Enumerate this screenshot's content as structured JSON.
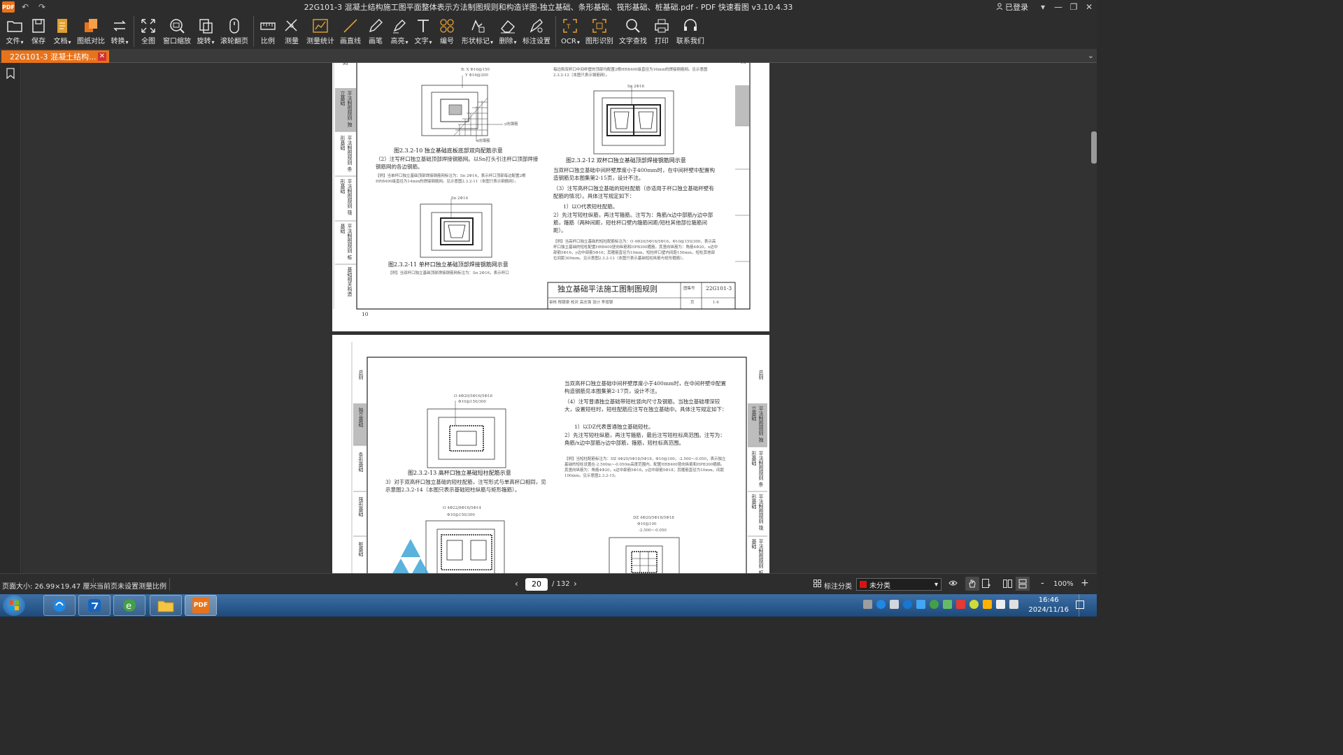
{
  "window": {
    "title": "22G101-3 混凝土结构施工图平面整体表示方法制图规则和构造详图-独立基础、条形基础、筏形基础、桩基础.pdf - PDF 快速看图 v3.10.4.33",
    "logo_text": "PDF",
    "login_label": "已登录"
  },
  "toolbar": {
    "items": [
      {
        "label": "文件",
        "icon": "folder-icon",
        "dropdown": true
      },
      {
        "label": "保存",
        "icon": "save-icon"
      },
      {
        "label": "文档",
        "icon": "document-icon",
        "dropdown": true
      },
      {
        "label": "图纸对比",
        "icon": "compare-icon"
      },
      {
        "label": "转换",
        "icon": "convert-icon",
        "dropdown": true
      },
      {
        "label": "全图",
        "icon": "fit-icon"
      },
      {
        "label": "窗口缩放",
        "icon": "zoom-window-icon"
      },
      {
        "label": "旋转",
        "icon": "rotate-icon",
        "dropdown": true
      },
      {
        "label": "滚轮翻页",
        "icon": "scroll-icon"
      },
      {
        "label": "比例",
        "icon": "scale-icon"
      },
      {
        "label": "测量",
        "icon": "measure-icon"
      },
      {
        "label": "测量统计",
        "icon": "measure-stats-icon"
      },
      {
        "label": "画直线",
        "icon": "line-icon"
      },
      {
        "label": "画笔",
        "icon": "pen-icon"
      },
      {
        "label": "高亮",
        "icon": "highlight-icon",
        "dropdown": true
      },
      {
        "label": "文字",
        "icon": "text-icon",
        "dropdown": true
      },
      {
        "label": "编号",
        "icon": "number-icon"
      },
      {
        "label": "形状标记",
        "icon": "shape-mark-icon",
        "dropdown": true
      },
      {
        "label": "删除",
        "icon": "eraser-icon",
        "dropdown": true
      },
      {
        "label": "标注设置",
        "icon": "annotation-settings-icon"
      },
      {
        "label": "OCR",
        "icon": "ocr-icon",
        "dropdown": true
      },
      {
        "label": "图形识别",
        "icon": "shape-recognition-icon"
      },
      {
        "label": "文字查找",
        "icon": "search-icon"
      },
      {
        "label": "打印",
        "icon": "print-icon"
      },
      {
        "label": "联系我们",
        "icon": "headset-icon"
      }
    ]
  },
  "tab": {
    "label": "22G101-3 混凝土结构...",
    "close": "✕"
  },
  "page1": {
    "top_label_left": "则",
    "top_label_right": "则",
    "fig1_annot1": "B: X Φ16@150",
    "fig1_annot2": "Y Φ16@200",
    "fig1_y": "y向钢筋",
    "fig1_x": "x向钢筋",
    "fig1_caption": "图2.3.2-10  独立基础底板底部双向配筋示意",
    "para1": "（2）注写杯口独立基础顶部焊接钢筋网。以Sn打头引注杯口顶部焊接钢筋网的各边钢筋。",
    "example1": "【例】当单杯口独立基础顶部焊接钢筋网标注为：Sn 2Φ14，表示杯口顶部每边配置2根HRB400级直径为14mm的焊接钢筋网。见示意图2.3.2-11（本图只表示钢筋网）。",
    "fig2_annot": "Sn 2Φ14",
    "fig2_caption": "图2.3.2-11  单杯口独立基础顶部焊接钢筋网示意",
    "example2": "【例】当双杯口独立基础顶部焊接钢筋网标注为：Sn 2Φ16，表示杯口",
    "right_top_text": "每边和双杯口中间杯壁的顶部均配置2根HRB400级直径为16mm的焊接钢筋网。见示意图2.3.2-12（本图只表示钢筋网）。",
    "fig3_annot": "Sn 2Φ16",
    "fig3_caption": "图2.3.2-12  双杯口独立基础顶部焊接钢筋网示意",
    "para2": "当双杯口独立基础中间杯壁厚度小于400mm时，在中间杯壁中配置构造钢筋见本图集第2-15页，设计不注。",
    "para3": "（3）注写高杯口独立基础的短柱配筋（亦适用于杯口独立基础杯壁有配筋的情况）。具体注写规定如下：",
    "para4": "1）以O代表短柱配筋。",
    "para5": "2）先注写短柱纵筋，再注写箍筋。注写为：角筋/x边中部筋/y边中部筋，箍筋（两种间距，短柱杯口壁内箍筋间距/短柱其他部位箍筋间距）。",
    "example3": "【例】当高杯口独立基础的短柱配筋标注为：O 4Φ20/5Φ16/5Φ16，Φ10@150/300，表示高杯口独立基础的短柱配置HRB400竖向纵筋和HPB300箍筋。其竖向纵筋为：角筋4Φ20，x边中部筋5Φ16，y边中部筋5Φ16；其箍筋直径为10mm，短柱杯口壁内间距150mm，短柱其他部位间距300mm。见示意图2.3.2-13（本图只表示基础短柱纵筋与矩形箍筋）。",
    "title_block_title": "独立基础平法施工图制图规则",
    "title_block_atlas_label": "图集号",
    "title_block_atlas": "22G101-3",
    "title_block_page_label": "页",
    "title_block_page": "1-6",
    "title_block_row": "审核  郁银泉   校对  高志强   设计  李增银",
    "page_number": "10",
    "side_tabs": [
      "平法制图规则 独立基础",
      "平法制图规则 条形基础",
      "平法制图规则 筏形基础",
      "平法制图规则 桩基础",
      "基础相关构造"
    ]
  },
  "page2": {
    "top_label": "总则",
    "fig4_annot1": "O 4Φ20/5Φ16/5Φ16",
    "fig4_annot2": "Φ10@150/300",
    "fig4_caption": "图2.3.2-13  高杯口独立基础短柱配筋示意",
    "para1": "3）对于双高杯口独立基础的短柱配筋，注写形式与单高杯口相同，见示意图2.3.2-14（本图只表示基础短柱纵筋与矩形箍筋）。",
    "fig5_annot1": "O 4Φ22/8Φ16/5Φ14",
    "fig5_annot2": "Φ10@150/300",
    "right_para1": "当双高杯口独立基础中间杯壁厚度小于400mm时，在中间杯壁中配置构造钢筋见本图集第2-17页，设计不注。",
    "right_para2": "（4）注写普通独立基础带短柱竖向尺寸及钢筋。当独立基础埋深较大，设置短柱时，短柱配筋应注写在独立基础中。具体注写规定如下：",
    "right_para3": "1）以DZ代表普通独立基础短柱。",
    "right_para4": "2）先注写短柱纵筋，再注写箍筋，最后注写短柱标高范围。注写为：角筋/x边中部筋/y边中部筋，箍筋，短柱标高范围。",
    "right_example": "【例】当短柱配筋标注为：DZ 4Φ20/5Φ18/5Φ18，Φ10@100，-2.500~-0.050，表示独立基础的短柱设置在-2.500m~-0.050m高度范围内，配置HRB400竖向纵筋和HPB300箍筋。其竖向纵筋为：角筋4Φ20，x边中部筋5Φ18，y边中部筋5Φ18；其箍筋直径为10mm，间距100mm。见示意图2.3.2-15。",
    "fig6_annot1": "DZ 4Φ20/5Φ18/5Φ18",
    "fig6_annot2": "Φ10@100",
    "fig6_annot3": "-2.500~-0.050",
    "right_tabs": [
      "总则",
      "平法制图规则 独立基础",
      "平法制图规则 条形基础",
      "平法制图规则 筏形基础",
      "平法制图规则 桩基础"
    ],
    "left_tabs": [
      "总则",
      "独立基础",
      "条形基础",
      "筏形基础",
      "桩基础"
    ]
  },
  "statusbar": {
    "page_size": "页面大小: 26.99×19.47 厘米",
    "scale_note": "当前页未设置测量比例",
    "current_page": "20",
    "total_pages": "/ 132",
    "annotation_category_label": "标注分类",
    "category_value": "未分类",
    "zoom": "100%",
    "zoom_minus": "-",
    "zoom_plus": "+"
  },
  "taskbar": {
    "time": "16:46",
    "date": "2024/11/16",
    "pdf_label": "PDF"
  },
  "colors": {
    "accent": "#e8731a",
    "tab_close": "#d32f2f",
    "category_swatch": "#e01010"
  }
}
